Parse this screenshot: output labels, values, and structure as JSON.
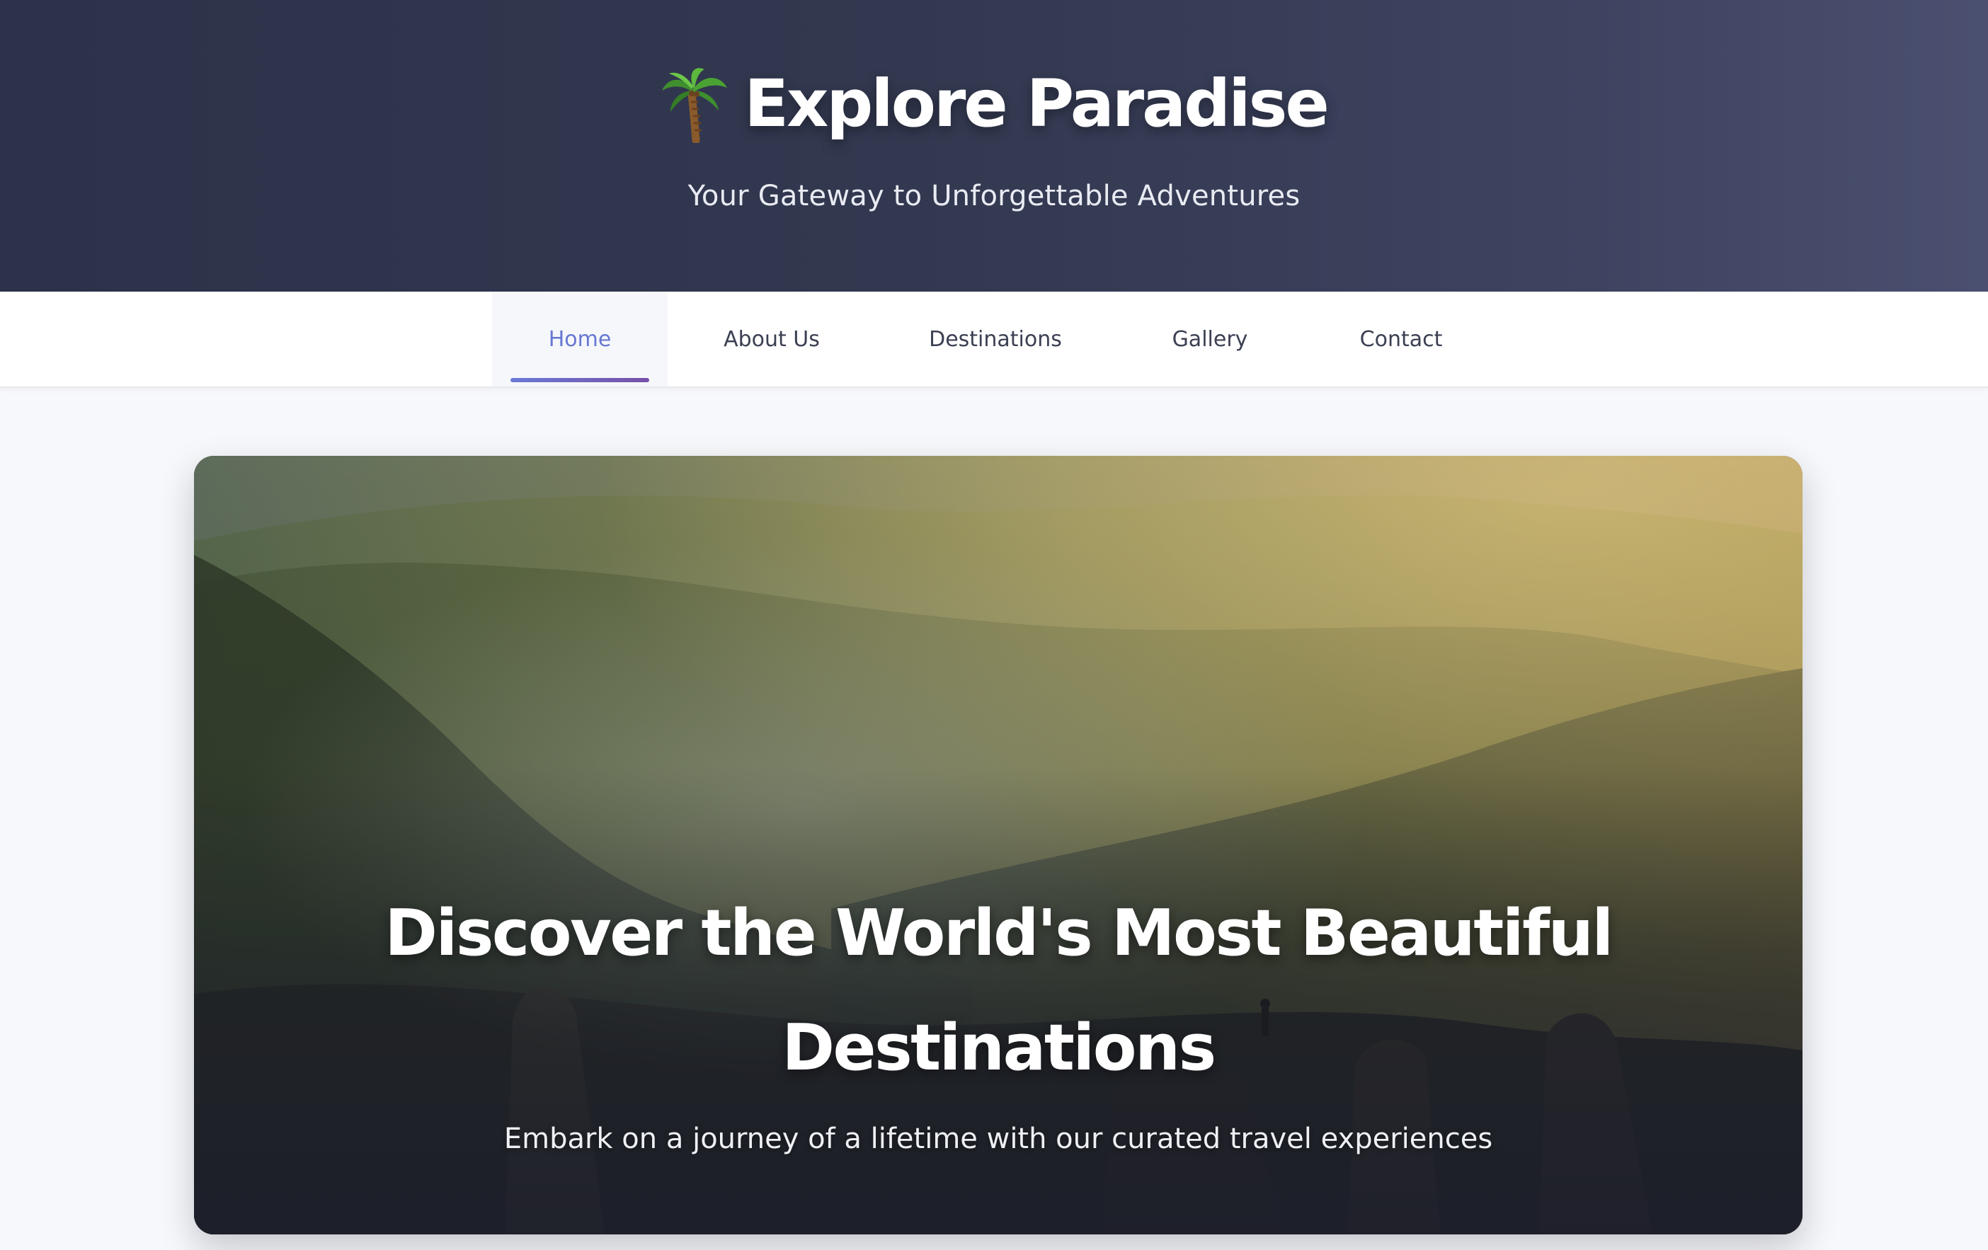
{
  "header": {
    "logo_icon": "palm-tree-icon",
    "title": "Explore Paradise",
    "tagline": "Your Gateway to Unforgettable Adventures"
  },
  "nav": {
    "items": [
      {
        "label": "Home",
        "active": true
      },
      {
        "label": "About Us",
        "active": false
      },
      {
        "label": "Destinations",
        "active": false
      },
      {
        "label": "Gallery",
        "active": false
      },
      {
        "label": "Contact",
        "active": false
      }
    ]
  },
  "hero": {
    "image": "misty-mountain-forest-landscape-with-lone-hiker",
    "title": "Discover the World's Most Beautiful Destinations",
    "subtitle": "Embark on a journey of a lifetime with our curated travel experiences"
  },
  "colors": {
    "header_bg": "#2c3249",
    "nav_active_text": "#6777d3",
    "nav_active_underline_start": "#6a7ad6",
    "nav_active_underline_end": "#7650a8",
    "nav_text": "#3b4052",
    "page_bg": "#f7f8fb"
  }
}
